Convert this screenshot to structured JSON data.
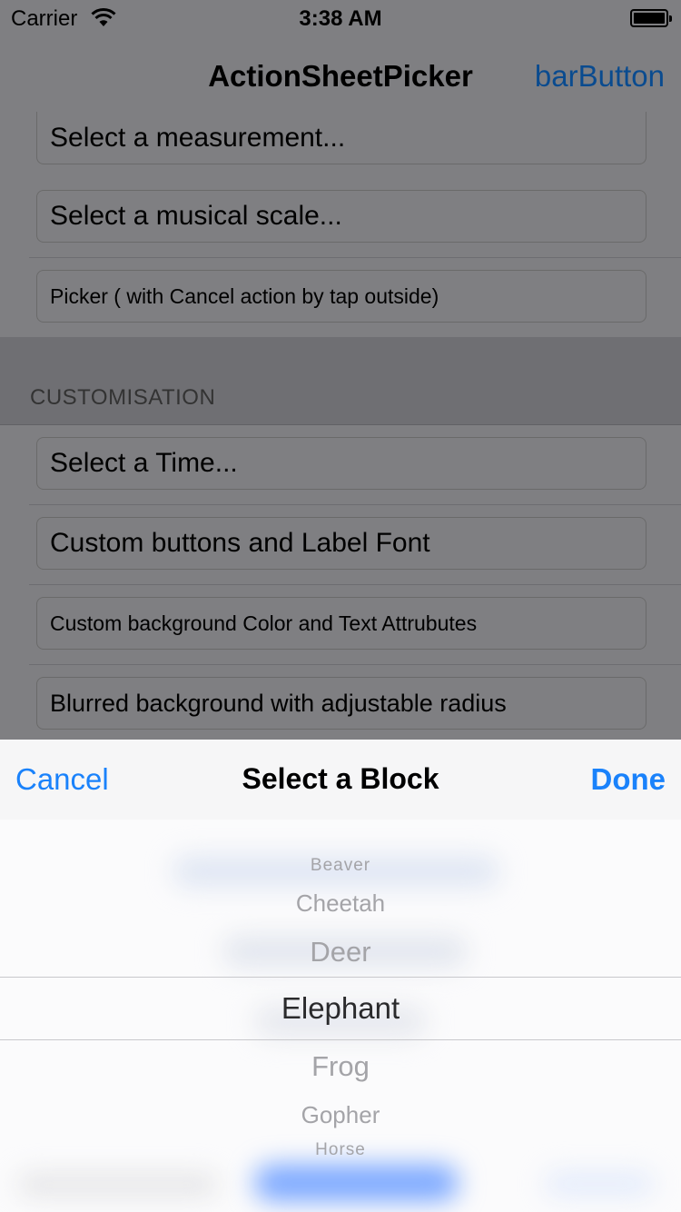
{
  "status_bar": {
    "carrier": "Carrier",
    "time": "3:38 AM",
    "wifi_icon": "wifi-icon",
    "battery_icon": "battery-icon"
  },
  "nav": {
    "title": "ActionSheetPicker",
    "right_button": "barButton"
  },
  "rows_top": [
    {
      "label": "Select a measurement..."
    },
    {
      "label": "Select a musical scale..."
    },
    {
      "label": "Picker ( with Cancel action by tap outside)"
    }
  ],
  "section": {
    "header": "CUSTOMISATION"
  },
  "rows_custom": [
    {
      "label": "Select a Time..."
    },
    {
      "label": "Custom buttons and Label Font"
    },
    {
      "label": "Custom background Color and Text Attrubutes"
    },
    {
      "label": "Blurred background with adjustable radius"
    }
  ],
  "action_sheet": {
    "cancel_label": "Cancel",
    "title": "Select a Block",
    "done_label": "Done",
    "picker_items": [
      "Beaver",
      "Cheetah",
      "Deer",
      "Elephant",
      "Frog",
      "Gopher",
      "Horse"
    ],
    "selected": "Elephant"
  },
  "colors": {
    "tint": "#1a82fb",
    "dimmed_tint": "#0a4b8f",
    "dim_background": "#7f7f82"
  }
}
